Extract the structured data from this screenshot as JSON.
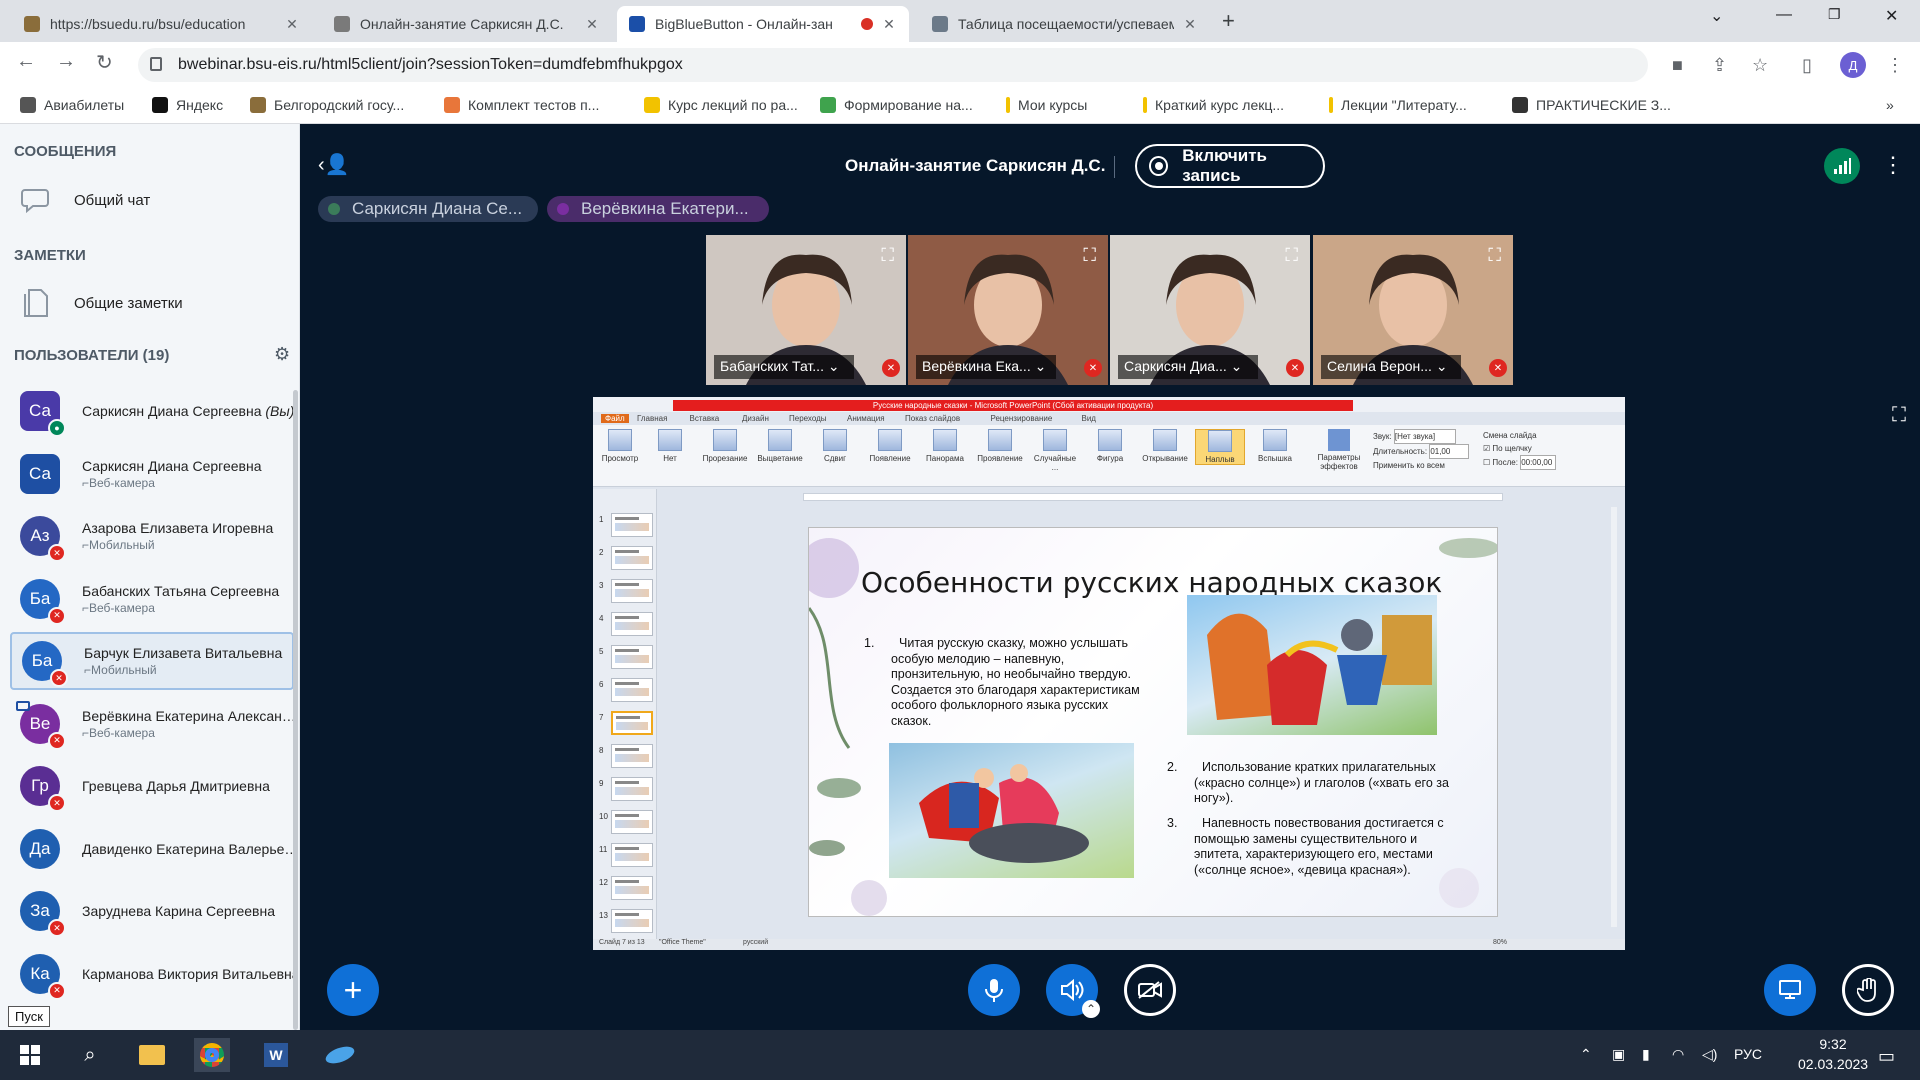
{
  "browser": {
    "tabs": [
      {
        "title": "https://bsuedu.ru/bsu/education",
        "favcolor": "#8a6d3b"
      },
      {
        "title": "Онлайн-занятие Саркисян Д.С.",
        "favcolor": "#7a7a7a"
      },
      {
        "title": "BigBlueButton - Онлайн-зан",
        "favcolor": "#1b4fa8"
      },
      {
        "title": "Таблица посещаемости/успеваем",
        "favcolor": "#6c7a89"
      }
    ],
    "url": "bwebinar.bsu-eis.ru/html5client/join?sessionToken=dumdfebmfhukpgox",
    "profile_initial": "Д",
    "bookmarks": [
      "Авиабилеты",
      "Яндекс",
      "Белгородский госу...",
      "Комплект тестов п...",
      "Курс лекций по ра...",
      "Формирование на...",
      "Мои курсы",
      "Краткий курс лекц...",
      "Лекции \"Литерату...",
      "ПРАКТИЧЕСКИЕ З..."
    ],
    "bookmarks_more": "»"
  },
  "sidebar": {
    "messages_heading": "СООБЩЕНИЯ",
    "public_chat": "Общий чат",
    "notes_heading": "ЗАМЕТКИ",
    "shared_notes": "Общие заметки",
    "users_heading": "ПОЛЬЗОВАТЕЛИ (19)",
    "users": [
      {
        "initials": "Са",
        "name": "Саркисян Диана Сергеевна",
        "you": "(Вы)",
        "sub": "",
        "color": "#4a3aa8",
        "badge": "green",
        "shape": "square"
      },
      {
        "initials": "Са",
        "name": "Саркисян Диана Сергеевна",
        "you": "",
        "sub": "Веб-камера",
        "color": "#1e4fa3",
        "badge": "",
        "shape": "square"
      },
      {
        "initials": "Аз",
        "name": "Азарова Елизавета Игоревна",
        "you": "",
        "sub": "Мобильный",
        "color": "#3b4a9c",
        "badge": "red",
        "shape": "round"
      },
      {
        "initials": "Ба",
        "name": "Бабанских Татьяна Сергеевна",
        "you": "",
        "sub": "Веб-камера",
        "color": "#2468c4",
        "badge": "red",
        "shape": "round"
      },
      {
        "initials": "Ба",
        "name": "Барчук Елизавета Витальевна",
        "you": "",
        "sub": "Мобильный",
        "color": "#2468c4",
        "badge": "red",
        "shape": "round"
      },
      {
        "initials": "Ве",
        "name": "Верёвкина Екатерина Александр...",
        "you": "",
        "sub": "Веб-камера",
        "color": "#7a2ea0",
        "badge": "red",
        "shape": "round"
      },
      {
        "initials": "Гр",
        "name": "Гревцева Дарья Дмитриевна",
        "you": "",
        "sub": "",
        "color": "#5a2e93",
        "badge": "red",
        "shape": "round"
      },
      {
        "initials": "Да",
        "name": "Давиденко Екатерина Валерьевна",
        "you": "",
        "sub": "",
        "color": "#1f5fb0",
        "badge": "",
        "shape": "round"
      },
      {
        "initials": "За",
        "name": "Заруднева Карина Сергеевна",
        "you": "",
        "sub": "",
        "color": "#1f5fb0",
        "badge": "red",
        "shape": "round"
      },
      {
        "initials": "Ка",
        "name": "Карманова Виктория Витальевна",
        "you": "",
        "sub": "",
        "color": "#1f5fb0",
        "badge": "red",
        "shape": "round"
      }
    ],
    "tooltip": "Пуск"
  },
  "meeting": {
    "title": "Онлайн-занятие Саркисян Д.С.",
    "record_label": "Включить запись",
    "talking_chips": [
      "Саркисян Диана Се...",
      "Верёвкина Екатери..."
    ],
    "videos": [
      {
        "name": "Бабанских Тат...",
        "bg": "#cfc7c1"
      },
      {
        "name": "Верёвкина Ека...",
        "bg": "#8f5b45"
      },
      {
        "name": "Саркисян Диа...",
        "bg": "#d8d4cf"
      },
      {
        "name": "Селина Верон...",
        "bg": "#caa688"
      }
    ]
  },
  "presentation": {
    "window_title": "Русские народные сказки - Microsoft PowerPoint (Сбой активации продукта)",
    "menu": [
      "Файл",
      "Главная",
      "Вставка",
      "Дизайн",
      "Переходы",
      "Анимация",
      "Показ слайдов",
      "Рецензирование",
      "Вид"
    ],
    "ribbon": [
      "Нет",
      "Прорезание",
      "Выцветание",
      "Сдвиг",
      "Появление",
      "Панорама",
      "Проявление",
      "Случайные ...",
      "Фигура",
      "Открывание",
      "Наплыв",
      "Вспышка"
    ],
    "ribbon_right": {
      "params": "Параметры эффектов",
      "sound_label": "Звук:",
      "sound_value": "[Нет звука]",
      "duration_label": "Длительность:",
      "duration_value": "01,00",
      "apply_all": "Применить ко всем",
      "change_slide": "Смена слайда",
      "on_click": "По щелчку",
      "after": "После:",
      "after_value": "00:00,00"
    },
    "preview": "Просмотр",
    "slide_title": "Особенности русских народных сказок",
    "items": [
      {
        "num": "1.",
        "text": "Читая русскую сказку, можно услышать особую мелодию – напевную, пронзительную, но необычайно твердую. Создается это благодаря характеристикам особого фольклорного языка русских сказок."
      },
      {
        "num": "2.",
        "text": "Использование кратких прилагательных («красно солнце») и глаголов («хвать его за ногу»)."
      },
      {
        "num": "3.",
        "text": "Напевность повествования достигается с помощью замены существительного и эпитета, характеризующего его, местами («солнце ясное», «девица красная»)."
      }
    ],
    "status": {
      "slide": "Слайд 7 из 13",
      "theme": "\"Office Theme\"",
      "lang": "русский",
      "zoom": "80%"
    },
    "thumb_numbers": [
      "1",
      "2",
      "3",
      "4",
      "5",
      "6",
      "7",
      "8",
      "9",
      "10",
      "11",
      "12",
      "13"
    ]
  },
  "taskbar": {
    "lang": "РУС",
    "time": "9:32",
    "date": "02.03.2023"
  }
}
